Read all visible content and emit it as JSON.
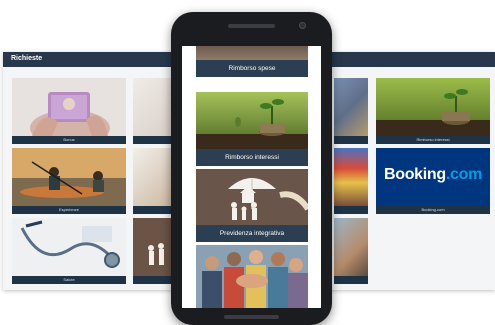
{
  "desktop": {
    "header_title": "Richieste",
    "tiles": [
      {
        "caption": "Bonus"
      },
      {
        "caption": "Esperienze"
      },
      {
        "caption": "Salute"
      },
      {
        "caption": "Rimborso interessi"
      },
      {
        "caption": "Booking.com"
      }
    ],
    "booking_logo": {
      "prefix": "Booking",
      "suffix": ".com"
    }
  },
  "mobile": {
    "cards": [
      {
        "caption": "Rimborso spese"
      },
      {
        "caption": "Rimborso interessi"
      },
      {
        "caption": "Previdenza integrativa"
      }
    ]
  },
  "colors": {
    "header": "#27384c",
    "caption_bar": "#1f3347",
    "booking": "#003580",
    "booking_dot": "#009fe3"
  }
}
